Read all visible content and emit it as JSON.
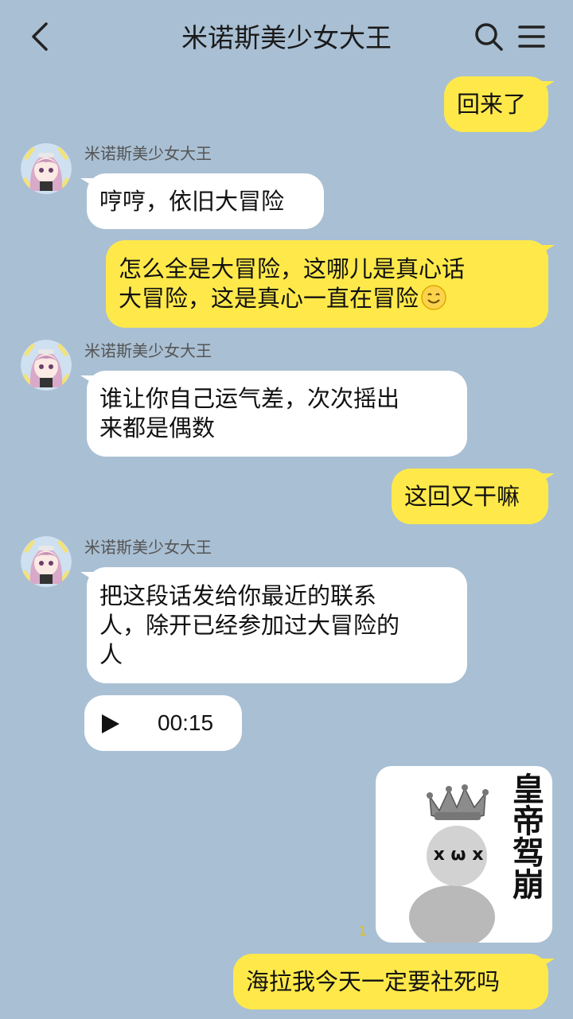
{
  "header": {
    "title": "米诺斯美少女大王",
    "back_icon": "chevron-left-icon",
    "search_icon": "search-icon",
    "menu_icon": "menu-icon"
  },
  "colors": {
    "background": "#a9bfd3",
    "my_bubble": "#ffe94a",
    "other_bubble": "#ffffff"
  },
  "messages": [
    {
      "from": "me",
      "text": "回来了"
    },
    {
      "from": "other",
      "sender": "米诺斯美少女大王",
      "text": "哼哼，依旧大冒险"
    },
    {
      "from": "me",
      "text": "怎么全是大冒险，这哪儿是真心话\n大冒险，这是真心一直在冒险",
      "emoji": "smile-emoji-icon"
    },
    {
      "from": "other",
      "sender": "米诺斯美少女大王",
      "text": "谁让你自己运气差，次次摇出\n来都是偶数"
    },
    {
      "from": "me",
      "text": "这回又干嘛"
    },
    {
      "from": "other",
      "sender": "米诺斯美少女大王",
      "text": "把这段话发给你最近的联系\n人，除开已经参加过大冒险的\n人"
    },
    {
      "from": "other",
      "type": "voice",
      "duration": "00:15"
    },
    {
      "from": "me",
      "type": "sticker",
      "sticker_text": "皇帝驾崩",
      "face": "x ω x"
    },
    {
      "from": "me",
      "text": "海拉我今天一定要社死吗"
    }
  ],
  "read_count": "1"
}
